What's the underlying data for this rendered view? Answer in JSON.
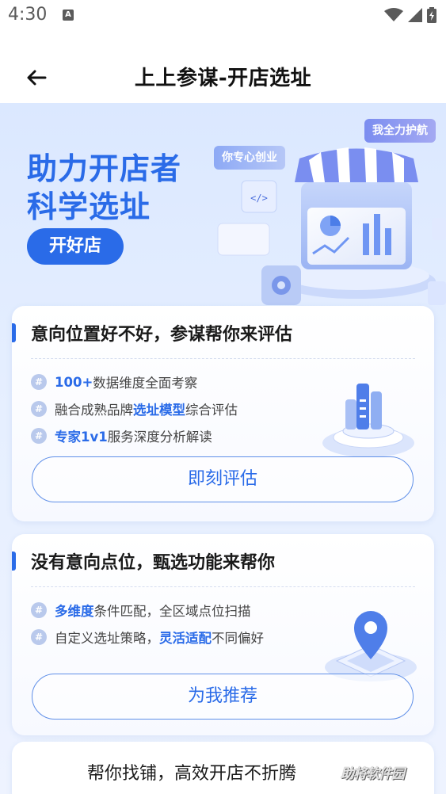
{
  "status": {
    "time": "4:30",
    "notif_glyph": "A",
    "icons": [
      "wifi-icon",
      "signal-icon",
      "battery-charging-icon"
    ]
  },
  "header": {
    "back_icon": "back-arrow-icon",
    "title": "上上参谋-开店选址"
  },
  "hero": {
    "line1": "助力开店者",
    "line2": "科学选址",
    "pill": "开好店",
    "bubble_1": "你专心创业",
    "bubble_2": "我全力护航"
  },
  "card1": {
    "title": "意向位置好不好，参谋帮你来评估",
    "features": [
      {
        "bold_prefix": "",
        "plain_prefix": "",
        "mid": "100+",
        "rest": " 数据维度全面考察"
      },
      {
        "plain_prefix": "融合成熟品牌",
        "bold": "选址模型",
        "rest": "综合评估"
      },
      {
        "bold": "专家1v1",
        "rest": " 服务深度分析解读"
      }
    ],
    "button": "即刻评估"
  },
  "card2": {
    "title": "没有意向点位，甄选功能来帮你",
    "features": [
      {
        "bold": "多维度",
        "rest": "条件匹配，全区域点位扫描"
      },
      {
        "plain_prefix": "自定义选址策略，",
        "bold": "灵活适配",
        "rest": "不同偏好"
      }
    ],
    "button": "为我推荐"
  },
  "footer": {
    "tagline": "帮你找铺，高效开店不折腾",
    "watermark": "助将软件园"
  },
  "colors": {
    "accent": "#2a6be8",
    "hero_bg": "#dbe8ff",
    "feature_bullet": "#b9c9ec"
  }
}
